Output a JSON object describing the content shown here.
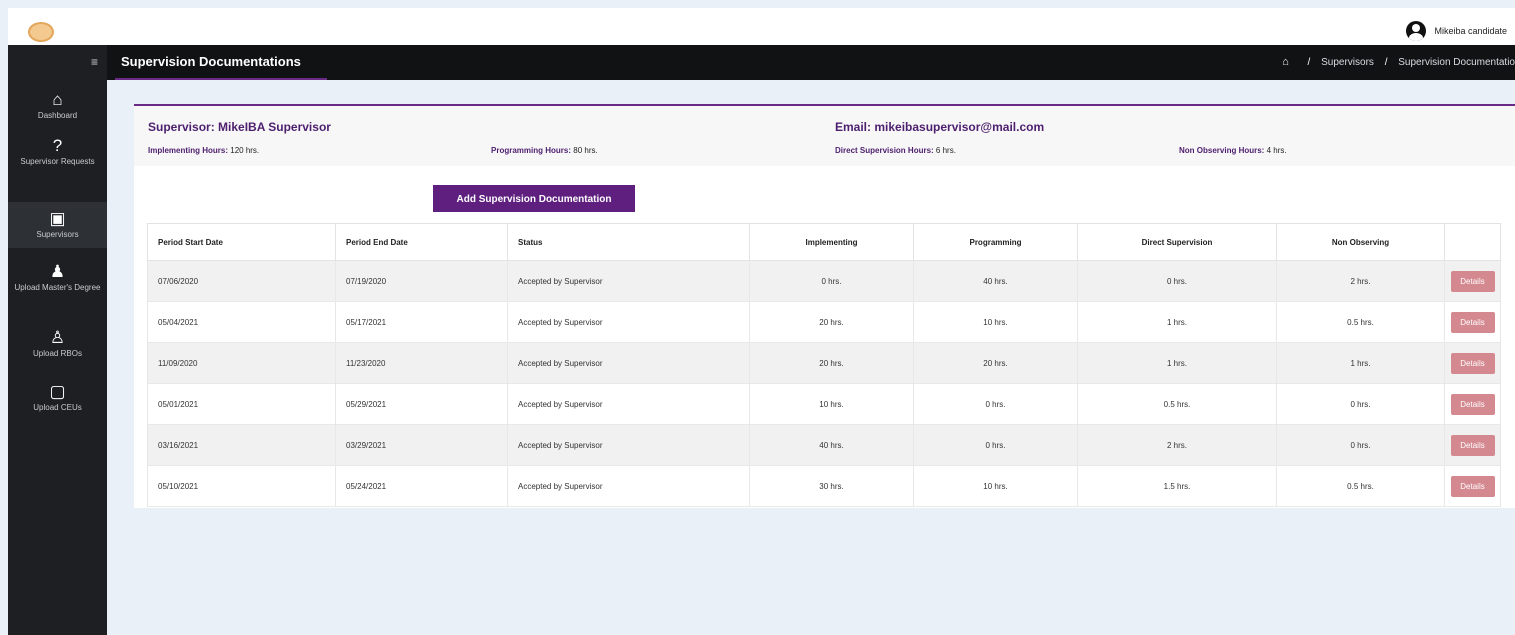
{
  "user": {
    "name": "Mikeiba candidate"
  },
  "sidebar": {
    "items": [
      {
        "label": "Dashboard",
        "icon": "home-icon"
      },
      {
        "label": "Supervisor Requests",
        "icon": "question-icon"
      },
      {
        "label": "Supervisors",
        "icon": "presentation-icon"
      },
      {
        "label": "Upload Master's Degree",
        "icon": "person-icon"
      },
      {
        "label": "Upload RBOs",
        "icon": "graduate-icon"
      },
      {
        "label": "Upload CEUs",
        "icon": "book-icon"
      }
    ],
    "active_index": 2
  },
  "header": {
    "title": "Supervision Documentations",
    "breadcrumbs": [
      "Supervisors",
      "Supervision Documentatio"
    ]
  },
  "supervisor": {
    "name_label": "Supervisor: MikeIBA Supervisor",
    "email_label": "Email: mikeibasupervisor@mail.com",
    "implementing": {
      "label": "Implementing Hours:",
      "value": "120 hrs."
    },
    "programming": {
      "label": "Programming Hours:",
      "value": "80 hrs."
    },
    "direct": {
      "label": "Direct Supervision Hours:",
      "value": "6 hrs."
    },
    "non_observing": {
      "label": "Non Observing Hours:",
      "value": "4 hrs."
    }
  },
  "add_button": "Add Supervision Documentation",
  "table": {
    "headers": [
      "Period Start Date",
      "Period End Date",
      "Status",
      "Implementing",
      "Programming",
      "Direct Supervision",
      "Non Observing",
      ""
    ],
    "details_label": "Details",
    "rows": [
      [
        "07/06/2020",
        "07/19/2020",
        "Accepted by Supervisor",
        "0 hrs.",
        "40 hrs.",
        "0 hrs.",
        "2 hrs."
      ],
      [
        "05/04/2021",
        "05/17/2021",
        "Accepted by Supervisor",
        "20 hrs.",
        "10 hrs.",
        "1 hrs.",
        "0.5 hrs."
      ],
      [
        "11/09/2020",
        "11/23/2020",
        "Accepted by Supervisor",
        "20 hrs.",
        "20 hrs.",
        "1 hrs.",
        "1 hrs."
      ],
      [
        "05/01/2021",
        "05/29/2021",
        "Accepted by Supervisor",
        "10 hrs.",
        "0 hrs.",
        "0.5 hrs.",
        "0 hrs."
      ],
      [
        "03/16/2021",
        "03/29/2021",
        "Accepted by Supervisor",
        "40 hrs.",
        "0 hrs.",
        "2 hrs.",
        "0 hrs."
      ],
      [
        "05/10/2021",
        "05/24/2021",
        "Accepted by Supervisor",
        "30 hrs.",
        "10 hrs.",
        "1.5 hrs.",
        "0.5 hrs."
      ]
    ]
  },
  "colors": {
    "accent": "#5e1f7f",
    "sidebar": "#1d1f22",
    "details": "#d4888f"
  }
}
